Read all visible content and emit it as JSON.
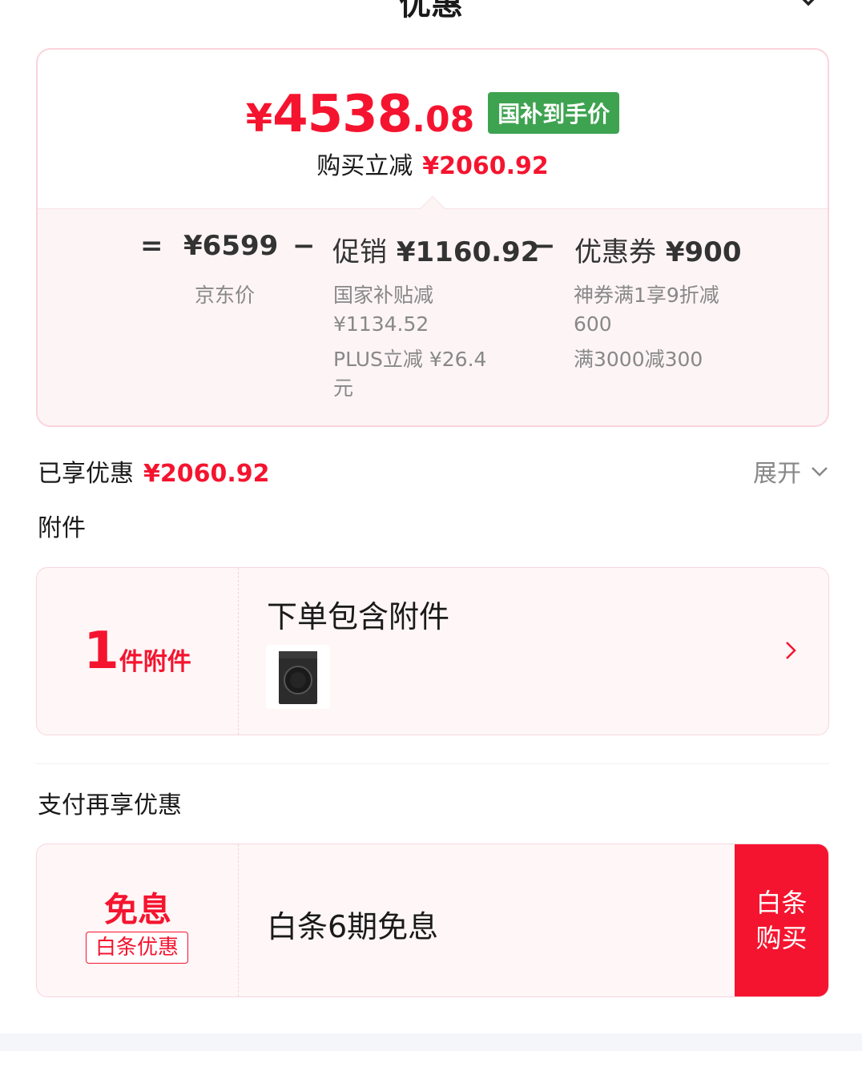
{
  "header": {
    "title": "优惠"
  },
  "price": {
    "currency": "¥",
    "integer": "4538",
    "decimal": ".08",
    "badge": "国补到手价",
    "reduce_label": "购买立减",
    "reduce_amount": "¥2060.92"
  },
  "formula": {
    "eq": "=",
    "jd_price": "¥6599",
    "minus1": "−",
    "promo_label": "促销",
    "promo_amount": "¥1160.92",
    "minus2": "−",
    "coupon_label": "优惠券",
    "coupon_amount": "¥900",
    "jd_label": "京东价",
    "promo_details": [
      "国家补贴减 ¥1134.52",
      "PLUS立减 ¥26.4元"
    ],
    "coupon_details": [
      "神券满1享9折减 600",
      "满3000减300"
    ]
  },
  "enjoyed": {
    "label": "已享优惠",
    "amount": "¥2060.92",
    "expand": "展开"
  },
  "accessories": {
    "section_title": "附件",
    "count": "1",
    "count_unit": "件附件",
    "name": "下单包含附件"
  },
  "payment": {
    "section_title": "支付再享优惠",
    "free_interest": "免息",
    "badge": "白条优惠",
    "name": "白条6期免息",
    "button_line1": "白条",
    "button_line2": "购买"
  },
  "colors": {
    "accent": "#f5142f",
    "badge_green": "#3ea350",
    "muted": "#888888"
  }
}
